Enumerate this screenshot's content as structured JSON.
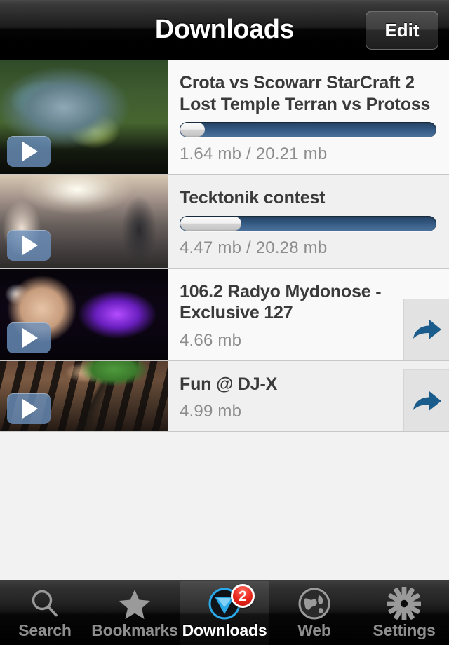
{
  "navbar": {
    "title": "Downloads",
    "edit_label": "Edit"
  },
  "downloads": [
    {
      "title": "Crota vs Scowarr StarCraft 2 Lost Temple Terran vs Protoss",
      "meta": "1.64 mb / 20.21 mb",
      "progress_percent": 8,
      "has_progress": true,
      "has_share": false,
      "thumb": "starcraft-minimap-thumbnail",
      "play_icon": "play-icon",
      "row_style": "light"
    },
    {
      "title": "Tecktonik contest",
      "meta": "4.47 mb / 20.28 mb",
      "progress_percent": 22,
      "has_progress": true,
      "has_share": false,
      "thumb": "dance-crowd-thumbnail",
      "play_icon": "play-icon",
      "row_style": "alt"
    },
    {
      "title": "106.2  Radyo Mydonose - Exclusive 127",
      "meta": "4.66 mb",
      "progress_percent": 0,
      "has_progress": false,
      "has_share": true,
      "thumb": "headphones-woman-thumbnail",
      "play_icon": "play-icon",
      "share_icon": "share-arrow-icon",
      "row_style": "light"
    },
    {
      "title": "Fun @ DJ-X",
      "meta": "4.99 mb",
      "progress_percent": 0,
      "has_progress": false,
      "has_share": true,
      "thumb": "synthesizer-keyboard-thumbnail",
      "play_icon": "play-icon",
      "share_icon": "share-arrow-icon",
      "row_style": "alt"
    }
  ],
  "tabbar": {
    "items": [
      {
        "label": "Search",
        "icon": "search-icon",
        "active": false,
        "badge": null
      },
      {
        "label": "Bookmarks",
        "icon": "star-icon",
        "active": false,
        "badge": null
      },
      {
        "label": "Downloads",
        "icon": "download-icon",
        "active": true,
        "badge": "2"
      },
      {
        "label": "Web",
        "icon": "globe-icon",
        "active": false,
        "badge": null
      },
      {
        "label": "Settings",
        "icon": "gear-icon",
        "active": false,
        "badge": null
      }
    ]
  },
  "colors": {
    "accent_blue": "#1a5c8c",
    "progress_track": "#2f5279",
    "progress_fill": "#efefef",
    "badge_red": "#e8261b",
    "download_icon_cyan": "#2aa8e8",
    "row_light": "#f9f9f9",
    "row_alt": "#f0f0f0",
    "title_text": "#3a3a3a",
    "meta_text": "#8c8c8c"
  }
}
